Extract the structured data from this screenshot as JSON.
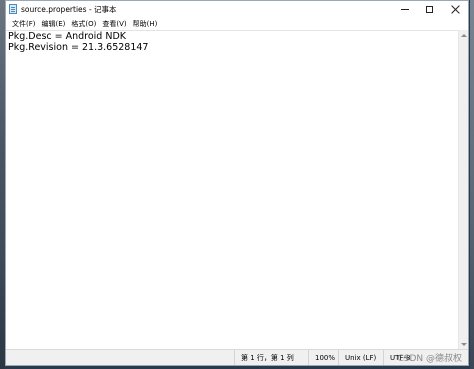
{
  "window": {
    "title": "source.properties - 记事本",
    "icon": "notepad-icon"
  },
  "menu": {
    "items": [
      {
        "label": "文件(F)"
      },
      {
        "label": "编辑(E)"
      },
      {
        "label": "格式(O)"
      },
      {
        "label": "查看(V)"
      },
      {
        "label": "帮助(H)"
      }
    ]
  },
  "editor": {
    "lines": [
      "Pkg.Desc = Android NDK",
      "Pkg.Revision = 21.3.6528147"
    ]
  },
  "statusbar": {
    "position": "第 1 行，第 1 列",
    "zoom": "100%",
    "line_ending": "Unix (LF)",
    "encoding": "UTF-8"
  },
  "watermark": "CSDN @德叔权"
}
